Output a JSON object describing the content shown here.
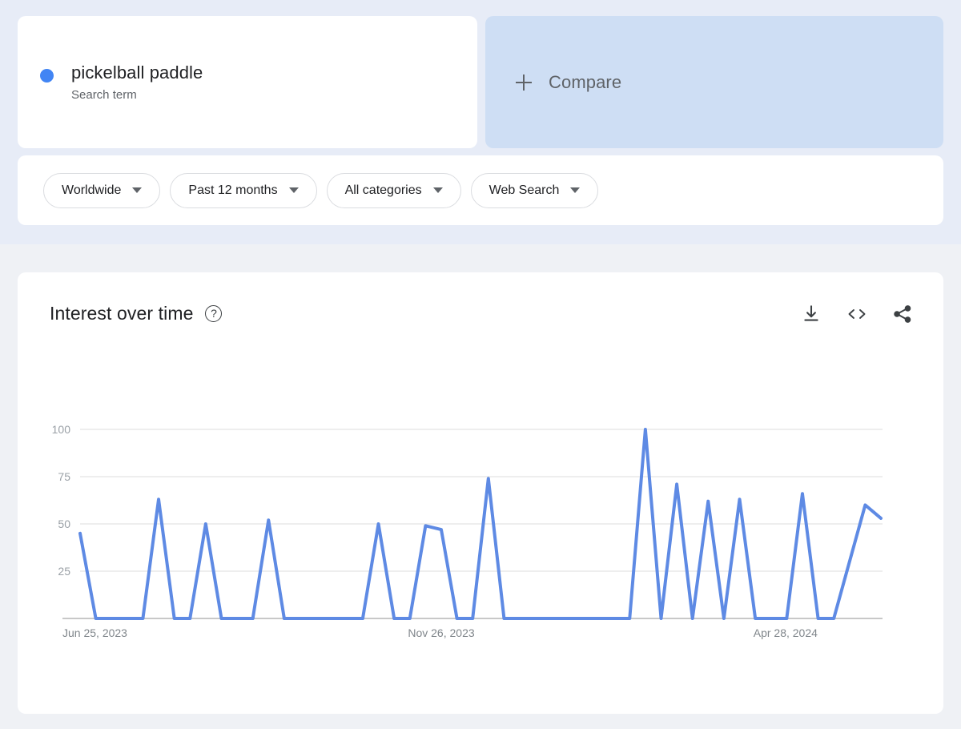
{
  "query": {
    "term": "pickelball paddle",
    "type_label": "Search term",
    "dot_color": "#4285f4"
  },
  "compare": {
    "label": "Compare",
    "plus_icon": "plus-icon"
  },
  "filters": [
    {
      "label": "Worldwide",
      "name": "location-filter"
    },
    {
      "label": "Past 12 months",
      "name": "time-range-filter"
    },
    {
      "label": "All categories",
      "name": "category-filter"
    },
    {
      "label": "Web Search",
      "name": "search-type-filter"
    }
  ],
  "chart_card": {
    "title": "Interest over time",
    "help_icon": "?",
    "actions": [
      {
        "name": "download-icon",
        "label": "Download CSV"
      },
      {
        "name": "embed-code-icon",
        "label": "Embed"
      },
      {
        "name": "share-icon",
        "label": "Share"
      }
    ]
  },
  "chart_data": {
    "type": "line",
    "title": "Interest over time",
    "xlabel": "",
    "ylabel": "",
    "ylim": [
      0,
      100
    ],
    "yticks": [
      25,
      50,
      75,
      100
    ],
    "grid": true,
    "legend": false,
    "line_color": "#5e8ae4",
    "x_tick_labels": [
      "Jun 25, 2023",
      "Nov 26, 2023",
      "Apr 28, 2024"
    ],
    "x_tick_indices": [
      0,
      22,
      44
    ],
    "series": [
      {
        "name": "pickelball paddle",
        "values": [
          45,
          0,
          0,
          0,
          0,
          63,
          0,
          0,
          50,
          0,
          0,
          0,
          52,
          0,
          0,
          0,
          0,
          0,
          0,
          50,
          0,
          0,
          49,
          47,
          0,
          0,
          74,
          0,
          0,
          0,
          0,
          0,
          0,
          0,
          0,
          0,
          100,
          0,
          71,
          0,
          62,
          0,
          63,
          0,
          0,
          0,
          66,
          0,
          0,
          30,
          60,
          53
        ]
      }
    ]
  }
}
